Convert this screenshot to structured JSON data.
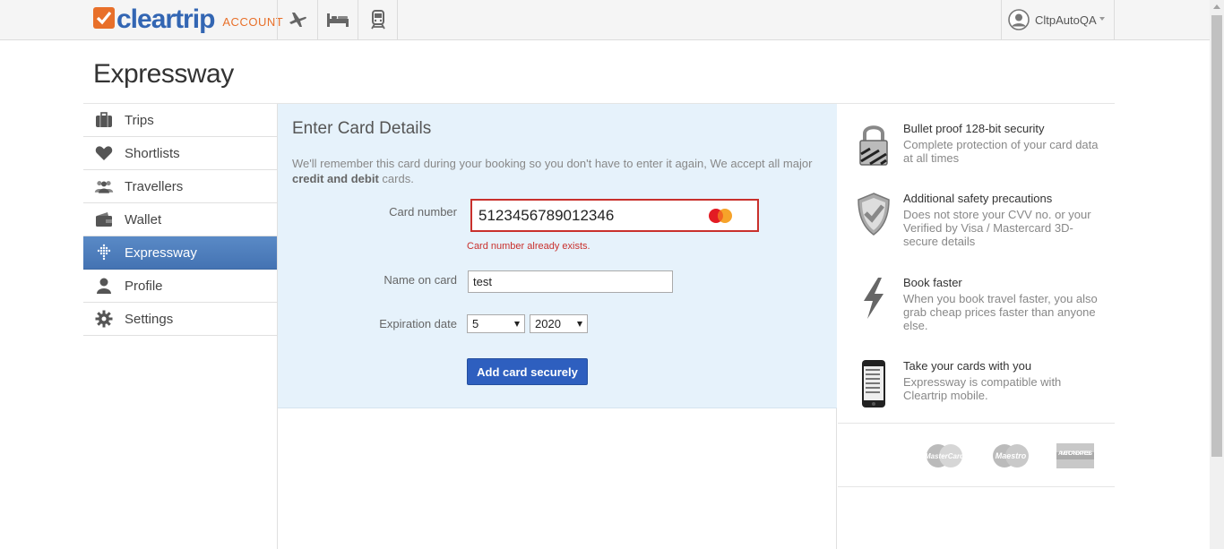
{
  "header": {
    "logo_text": "cleartrip",
    "logo_sub": "ACCOUNT",
    "nav_icons": [
      "plane-icon",
      "hotel-icon",
      "train-icon"
    ],
    "user_name": "CltpAutoQA"
  },
  "page": {
    "title": "Expressway"
  },
  "sidebar": {
    "items": [
      {
        "label": "Trips",
        "icon": "briefcase-icon"
      },
      {
        "label": "Shortlists",
        "icon": "heart-icon"
      },
      {
        "label": "Travellers",
        "icon": "people-icon"
      },
      {
        "label": "Wallet",
        "icon": "wallet-icon"
      },
      {
        "label": "Expressway",
        "icon": "expressway-icon",
        "active": true
      },
      {
        "label": "Profile",
        "icon": "person-icon"
      },
      {
        "label": "Settings",
        "icon": "gear-icon"
      }
    ]
  },
  "card_form": {
    "title": "Enter Card Details",
    "desc_part1": "We'll remember this card during your booking so you don't have to enter it again, We accept all major ",
    "desc_bold": "credit and debit",
    "desc_part2": " cards.",
    "card_number_label": "Card number",
    "card_number_value": "5123456789012346",
    "card_number_error": "Card number already exists.",
    "name_label": "Name on card",
    "name_value": "test",
    "expiry_label": "Expiration date",
    "expiry_month": "5",
    "expiry_year": "2020",
    "submit_label": "Add card securely"
  },
  "features": [
    {
      "title": "Bullet proof 128-bit security",
      "desc": "Complete protection of your card data at all times",
      "icon": "lock-icon"
    },
    {
      "title": "Additional safety precautions",
      "desc": "Does not store your CVV no. or your Verified by Visa / Mastercard 3D-secure details",
      "icon": "shield-icon"
    },
    {
      "title": "Book faster",
      "desc": "When you book travel faster, you also grab cheap prices faster than anyone else.",
      "icon": "lightning-icon"
    },
    {
      "title": "Take your cards with you",
      "desc": "Expressway is compatible with Cleartrip mobile.",
      "icon": "phone-icon"
    }
  ],
  "card_brands": [
    "MasterCard",
    "Maestro",
    "AMERICAN EXPRESS"
  ],
  "colors": {
    "brand_orange": "#e8702a",
    "brand_blue": "#3366b3",
    "active_nav": "#4d7cba",
    "error": "#c9302c",
    "button": "#2e5fbf",
    "panel_bg": "#e6f2fb"
  }
}
